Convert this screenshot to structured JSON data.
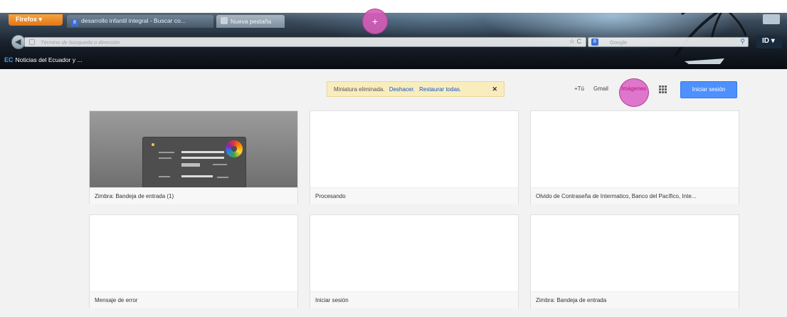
{
  "browser": {
    "menu_label": "Firefox ▾",
    "tabs": [
      {
        "title": "desarrollo infantil integral - Buscar co...",
        "active": true
      },
      {
        "title": "Nueva pestaña",
        "active": false
      }
    ],
    "new_tab_label": "+",
    "url_placeholder": "Término de búsqueda o dirección",
    "search_engine": "Google",
    "toolbar_extension_label": "ID ▾",
    "bookmarks": [
      {
        "label": "Noticias del Ecuador y ...",
        "icon_text": "EC"
      }
    ]
  },
  "notice": {
    "message": "Miniatura eliminada.",
    "undo": "Deshacer.",
    "restore_all": "Restaurar todas.",
    "close": "✕"
  },
  "google_bar": {
    "plus_you": "+Tú",
    "gmail": "Gmail",
    "images": "Imágenes",
    "sign_in": "Iniciar sesión"
  },
  "tiles": [
    {
      "caption": "Zimbra: Bandeja de entrada (1)",
      "thumbnail": "zimbra-login"
    },
    {
      "caption": "Procesando",
      "thumbnail": "blank"
    },
    {
      "caption": "Olvido de Contraseña de Intermatico, Banco del Pacífico, Inte...",
      "thumbnail": "blank"
    },
    {
      "caption": "Mensaje de error",
      "thumbnail": "blank"
    },
    {
      "caption": "Iniciar sesión",
      "thumbnail": "blank"
    },
    {
      "caption": "Zimbra: Bandeja de entrada",
      "thumbnail": "blank"
    }
  ],
  "colors": {
    "firefox_orange": "#e8801f",
    "highlight_pink": "#d65cb8",
    "signin_blue": "#4d90fe",
    "link_blue": "#1155cc",
    "notice_bg": "#f9edbe"
  }
}
